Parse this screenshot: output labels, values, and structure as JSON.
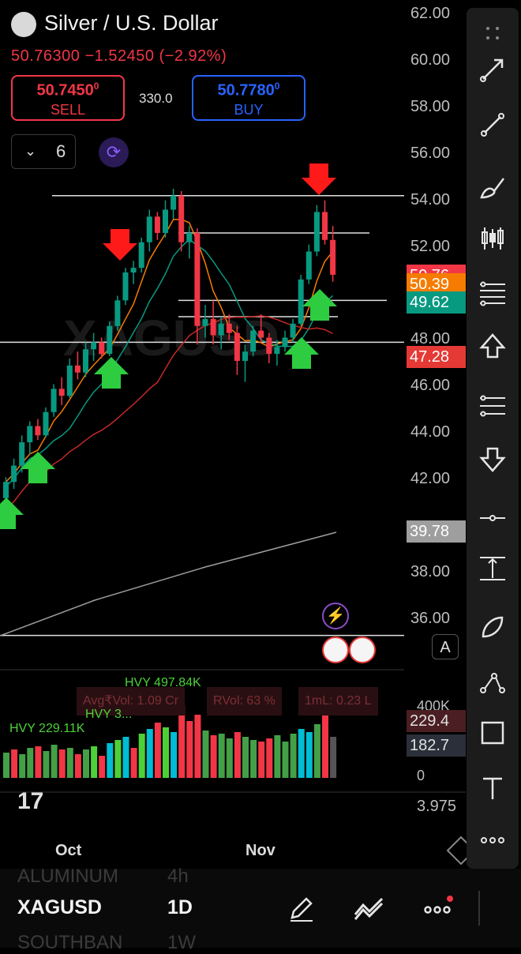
{
  "header": {
    "title": "Silver / U.S. Dollar",
    "last_price": "50.76300",
    "change": "−1.52450",
    "change_pct": "(−2.92%)"
  },
  "trade": {
    "sell_price": "50.7450",
    "sell_price_sup": "0",
    "sell_label": "SELL",
    "spread": "330.0",
    "buy_price": "50.7780",
    "buy_price_sup": "0",
    "buy_label": "BUY"
  },
  "interval_selector": {
    "value": "6"
  },
  "price_axis": {
    "ticks": [
      "62.00",
      "60.00",
      "58.00",
      "56.00",
      "54.00",
      "52.00",
      "48.00",
      "46.00",
      "44.00",
      "42.00",
      "38.00",
      "36.00"
    ],
    "tags": [
      {
        "text": "50.76",
        "color": "#f23645"
      },
      {
        "text": "50.39",
        "color": "#f57c00"
      },
      {
        "text": "49.62",
        "color": "#089981"
      },
      {
        "text": "47.28",
        "color": "#e53935"
      },
      {
        "text": "39.78",
        "color": "#9e9e9e"
      }
    ]
  },
  "watermark": "XAGUSD",
  "volume_pane": {
    "chips": [
      "Avg₹Vol: 1.09 Cr",
      "RVol: 63 %",
      "1mL: 0.23 L"
    ],
    "hvy_labels": [
      "HVY 497.84K",
      "HVY 229.11K",
      "HVY 3..."
    ],
    "axis_labels": [
      "400K",
      "0",
      "3.975"
    ],
    "tags": [
      {
        "text": "229.4",
        "color": "#7a2f35"
      },
      {
        "text": "182.7",
        "color": "#2b2f3a"
      }
    ]
  },
  "time_axis": {
    "labels": [
      "Oct",
      "Nov"
    ],
    "partial": "17"
  },
  "bottom_bar": {
    "symbol": "XAGUSD",
    "timeframe": "1D",
    "prev_symbol": "ALUMINUM",
    "prev_tf": "4h",
    "next_symbol": "SOUTHBAN",
    "next_tf": "1W"
  },
  "toolbar": {
    "items": [
      "more-icon",
      "arrow-line-icon",
      "trend-line-icon",
      "brush-icon",
      "long-position-icon",
      "fib-icon",
      "arrow-up-icon",
      "fib-extension-icon",
      "arrow-down-icon",
      "horizontal-ray-icon",
      "price-range-icon",
      "arc-icon",
      "path-icon",
      "rectangle-icon",
      "text-icon",
      "more-icon"
    ]
  },
  "chart_data": {
    "type": "candlestick",
    "title": "Silver / U.S. Dollar",
    "ylim": [
      35,
      62
    ],
    "x_labels": [
      "Oct",
      "Nov"
    ],
    "candles_ohlc": [
      [
        41.2,
        42.1,
        40.9,
        41.9
      ],
      [
        41.9,
        42.9,
        41.6,
        42.6
      ],
      [
        42.6,
        43.9,
        42.3,
        43.6
      ],
      [
        43.6,
        44.5,
        43.1,
        44.3
      ],
      [
        44.3,
        44.6,
        43.7,
        43.9
      ],
      [
        43.9,
        45.1,
        43.8,
        44.9
      ],
      [
        44.9,
        46.1,
        44.7,
        45.9
      ],
      [
        45.9,
        46.4,
        45.2,
        45.6
      ],
      [
        45.6,
        47.2,
        45.5,
        46.9
      ],
      [
        46.9,
        47.5,
        46.3,
        46.6
      ],
      [
        46.6,
        47.9,
        46.4,
        47.6
      ],
      [
        47.6,
        48.3,
        47.1,
        47.9
      ],
      [
        47.9,
        48.1,
        47.2,
        47.4
      ],
      [
        47.4,
        48.8,
        47.3,
        48.6
      ],
      [
        48.6,
        49.9,
        48.4,
        49.7
      ],
      [
        49.7,
        51.1,
        49.5,
        50.9
      ],
      [
        50.9,
        51.4,
        50.4,
        51.1
      ],
      [
        51.1,
        52.4,
        50.9,
        52.2
      ],
      [
        52.2,
        53.6,
        51.8,
        53.3
      ],
      [
        53.3,
        53.5,
        52.3,
        52.6
      ],
      [
        52.6,
        54.0,
        52.4,
        53.6
      ],
      [
        53.6,
        54.5,
        53.2,
        54.2
      ],
      [
        54.2,
        54.4,
        51.8,
        52.2
      ],
      [
        52.2,
        52.9,
        51.5,
        52.6
      ],
      [
        52.6,
        52.8,
        47.8,
        48.6
      ],
      [
        48.6,
        49.5,
        48.1,
        48.9
      ],
      [
        48.9,
        49.7,
        47.8,
        48.2
      ],
      [
        48.2,
        49.0,
        47.6,
        48.7
      ],
      [
        48.7,
        49.1,
        48.0,
        48.3
      ],
      [
        48.3,
        48.6,
        46.5,
        47.1
      ],
      [
        47.1,
        47.8,
        46.2,
        47.5
      ],
      [
        47.5,
        48.6,
        47.3,
        48.4
      ],
      [
        48.4,
        49.1,
        47.9,
        48.1
      ],
      [
        48.1,
        48.3,
        47.0,
        47.4
      ],
      [
        47.4,
        48.0,
        46.9,
        47.7
      ],
      [
        47.7,
        48.4,
        47.5,
        48.1
      ],
      [
        48.1,
        48.9,
        47.9,
        48.7
      ],
      [
        48.7,
        50.8,
        48.6,
        50.6
      ],
      [
        50.6,
        52.1,
        50.4,
        51.8
      ],
      [
        51.8,
        53.8,
        51.6,
        53.5
      ],
      [
        53.5,
        54.0,
        52.1,
        52.3
      ],
      [
        52.3,
        52.9,
        50.5,
        50.8
      ]
    ],
    "horizontal_levels": [
      54.2,
      52.6,
      49.7,
      49.0,
      47.9,
      35.3
    ]
  }
}
